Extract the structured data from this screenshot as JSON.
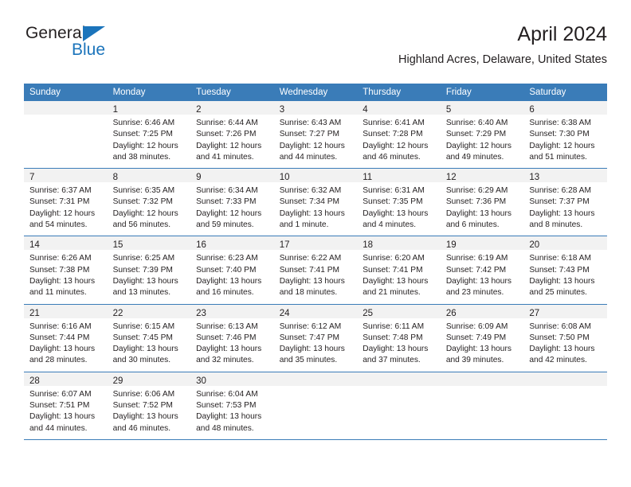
{
  "brand": {
    "name_part1": "General",
    "name_part2": "Blue",
    "color_dark": "#231f20",
    "color_blue": "#1b74bb"
  },
  "header": {
    "title": "April 2024",
    "subtitle": "Highland Acres, Delaware, United States"
  },
  "theme": {
    "header_blue": "#3a7cb8",
    "date_strip_gray": "#f2f2f2",
    "text": "#231f20"
  },
  "weekdays": [
    "Sunday",
    "Monday",
    "Tuesday",
    "Wednesday",
    "Thursday",
    "Friday",
    "Saturday"
  ],
  "weeks": [
    [
      {
        "day": "",
        "sunrise": "",
        "sunset": "",
        "daylight_line1": "",
        "daylight_line2": ""
      },
      {
        "day": "1",
        "sunrise": "Sunrise: 6:46 AM",
        "sunset": "Sunset: 7:25 PM",
        "daylight_line1": "Daylight: 12 hours",
        "daylight_line2": "and 38 minutes."
      },
      {
        "day": "2",
        "sunrise": "Sunrise: 6:44 AM",
        "sunset": "Sunset: 7:26 PM",
        "daylight_line1": "Daylight: 12 hours",
        "daylight_line2": "and 41 minutes."
      },
      {
        "day": "3",
        "sunrise": "Sunrise: 6:43 AM",
        "sunset": "Sunset: 7:27 PM",
        "daylight_line1": "Daylight: 12 hours",
        "daylight_line2": "and 44 minutes."
      },
      {
        "day": "4",
        "sunrise": "Sunrise: 6:41 AM",
        "sunset": "Sunset: 7:28 PM",
        "daylight_line1": "Daylight: 12 hours",
        "daylight_line2": "and 46 minutes."
      },
      {
        "day": "5",
        "sunrise": "Sunrise: 6:40 AM",
        "sunset": "Sunset: 7:29 PM",
        "daylight_line1": "Daylight: 12 hours",
        "daylight_line2": "and 49 minutes."
      },
      {
        "day": "6",
        "sunrise": "Sunrise: 6:38 AM",
        "sunset": "Sunset: 7:30 PM",
        "daylight_line1": "Daylight: 12 hours",
        "daylight_line2": "and 51 minutes."
      }
    ],
    [
      {
        "day": "7",
        "sunrise": "Sunrise: 6:37 AM",
        "sunset": "Sunset: 7:31 PM",
        "daylight_line1": "Daylight: 12 hours",
        "daylight_line2": "and 54 minutes."
      },
      {
        "day": "8",
        "sunrise": "Sunrise: 6:35 AM",
        "sunset": "Sunset: 7:32 PM",
        "daylight_line1": "Daylight: 12 hours",
        "daylight_line2": "and 56 minutes."
      },
      {
        "day": "9",
        "sunrise": "Sunrise: 6:34 AM",
        "sunset": "Sunset: 7:33 PM",
        "daylight_line1": "Daylight: 12 hours",
        "daylight_line2": "and 59 minutes."
      },
      {
        "day": "10",
        "sunrise": "Sunrise: 6:32 AM",
        "sunset": "Sunset: 7:34 PM",
        "daylight_line1": "Daylight: 13 hours",
        "daylight_line2": "and 1 minute."
      },
      {
        "day": "11",
        "sunrise": "Sunrise: 6:31 AM",
        "sunset": "Sunset: 7:35 PM",
        "daylight_line1": "Daylight: 13 hours",
        "daylight_line2": "and 4 minutes."
      },
      {
        "day": "12",
        "sunrise": "Sunrise: 6:29 AM",
        "sunset": "Sunset: 7:36 PM",
        "daylight_line1": "Daylight: 13 hours",
        "daylight_line2": "and 6 minutes."
      },
      {
        "day": "13",
        "sunrise": "Sunrise: 6:28 AM",
        "sunset": "Sunset: 7:37 PM",
        "daylight_line1": "Daylight: 13 hours",
        "daylight_line2": "and 8 minutes."
      }
    ],
    [
      {
        "day": "14",
        "sunrise": "Sunrise: 6:26 AM",
        "sunset": "Sunset: 7:38 PM",
        "daylight_line1": "Daylight: 13 hours",
        "daylight_line2": "and 11 minutes."
      },
      {
        "day": "15",
        "sunrise": "Sunrise: 6:25 AM",
        "sunset": "Sunset: 7:39 PM",
        "daylight_line1": "Daylight: 13 hours",
        "daylight_line2": "and 13 minutes."
      },
      {
        "day": "16",
        "sunrise": "Sunrise: 6:23 AM",
        "sunset": "Sunset: 7:40 PM",
        "daylight_line1": "Daylight: 13 hours",
        "daylight_line2": "and 16 minutes."
      },
      {
        "day": "17",
        "sunrise": "Sunrise: 6:22 AM",
        "sunset": "Sunset: 7:41 PM",
        "daylight_line1": "Daylight: 13 hours",
        "daylight_line2": "and 18 minutes."
      },
      {
        "day": "18",
        "sunrise": "Sunrise: 6:20 AM",
        "sunset": "Sunset: 7:41 PM",
        "daylight_line1": "Daylight: 13 hours",
        "daylight_line2": "and 21 minutes."
      },
      {
        "day": "19",
        "sunrise": "Sunrise: 6:19 AM",
        "sunset": "Sunset: 7:42 PM",
        "daylight_line1": "Daylight: 13 hours",
        "daylight_line2": "and 23 minutes."
      },
      {
        "day": "20",
        "sunrise": "Sunrise: 6:18 AM",
        "sunset": "Sunset: 7:43 PM",
        "daylight_line1": "Daylight: 13 hours",
        "daylight_line2": "and 25 minutes."
      }
    ],
    [
      {
        "day": "21",
        "sunrise": "Sunrise: 6:16 AM",
        "sunset": "Sunset: 7:44 PM",
        "daylight_line1": "Daylight: 13 hours",
        "daylight_line2": "and 28 minutes."
      },
      {
        "day": "22",
        "sunrise": "Sunrise: 6:15 AM",
        "sunset": "Sunset: 7:45 PM",
        "daylight_line1": "Daylight: 13 hours",
        "daylight_line2": "and 30 minutes."
      },
      {
        "day": "23",
        "sunrise": "Sunrise: 6:13 AM",
        "sunset": "Sunset: 7:46 PM",
        "daylight_line1": "Daylight: 13 hours",
        "daylight_line2": "and 32 minutes."
      },
      {
        "day": "24",
        "sunrise": "Sunrise: 6:12 AM",
        "sunset": "Sunset: 7:47 PM",
        "daylight_line1": "Daylight: 13 hours",
        "daylight_line2": "and 35 minutes."
      },
      {
        "day": "25",
        "sunrise": "Sunrise: 6:11 AM",
        "sunset": "Sunset: 7:48 PM",
        "daylight_line1": "Daylight: 13 hours",
        "daylight_line2": "and 37 minutes."
      },
      {
        "day": "26",
        "sunrise": "Sunrise: 6:09 AM",
        "sunset": "Sunset: 7:49 PM",
        "daylight_line1": "Daylight: 13 hours",
        "daylight_line2": "and 39 minutes."
      },
      {
        "day": "27",
        "sunrise": "Sunrise: 6:08 AM",
        "sunset": "Sunset: 7:50 PM",
        "daylight_line1": "Daylight: 13 hours",
        "daylight_line2": "and 42 minutes."
      }
    ],
    [
      {
        "day": "28",
        "sunrise": "Sunrise: 6:07 AM",
        "sunset": "Sunset: 7:51 PM",
        "daylight_line1": "Daylight: 13 hours",
        "daylight_line2": "and 44 minutes."
      },
      {
        "day": "29",
        "sunrise": "Sunrise: 6:06 AM",
        "sunset": "Sunset: 7:52 PM",
        "daylight_line1": "Daylight: 13 hours",
        "daylight_line2": "and 46 minutes."
      },
      {
        "day": "30",
        "sunrise": "Sunrise: 6:04 AM",
        "sunset": "Sunset: 7:53 PM",
        "daylight_line1": "Daylight: 13 hours",
        "daylight_line2": "and 48 minutes."
      },
      {
        "day": "",
        "sunrise": "",
        "sunset": "",
        "daylight_line1": "",
        "daylight_line2": ""
      },
      {
        "day": "",
        "sunrise": "",
        "sunset": "",
        "daylight_line1": "",
        "daylight_line2": ""
      },
      {
        "day": "",
        "sunrise": "",
        "sunset": "",
        "daylight_line1": "",
        "daylight_line2": ""
      },
      {
        "day": "",
        "sunrise": "",
        "sunset": "",
        "daylight_line1": "",
        "daylight_line2": ""
      }
    ]
  ]
}
